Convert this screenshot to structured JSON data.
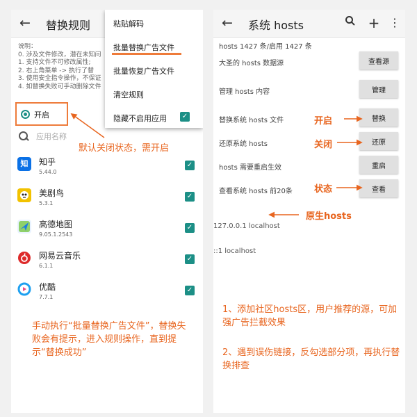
{
  "left": {
    "title": "替换规则",
    "description_lines": [
      "说明：",
      "0. 涉及文件修改，潜在未知问",
      "1. 支持文件不可修改属性;",
      "2. 右上角菜单 -> 执行了替",
      "3. 使用安全指令操作，不保证",
      "4. 如替换失败可手动删除文件"
    ],
    "toggle_label": "开启",
    "search_placeholder": "应用名称",
    "apps": [
      {
        "name": "知乎",
        "version": "5.44.0",
        "icon": "zhihu-icon",
        "glyph": "知",
        "color": "#0b71e6",
        "checked": true
      },
      {
        "name": "美剧鸟",
        "version": "5.3.1",
        "icon": "meijuniao-icon",
        "glyph": "",
        "color": "#f2c200",
        "checked": true
      },
      {
        "name": "高德地图",
        "version": "9.05.1.2543",
        "icon": "amap-icon",
        "glyph": "",
        "color": "#3b8eea",
        "checked": true
      },
      {
        "name": "网易云音乐",
        "version": "6.1.1",
        "icon": "netease-music-icon",
        "glyph": "",
        "color": "#dd2a2a",
        "checked": true
      },
      {
        "name": "优酷",
        "version": "7.7.1",
        "icon": "youku-icon",
        "glyph": "",
        "color": "#1ea0f0",
        "checked": true
      }
    ],
    "menu": {
      "items": [
        "粘贴解码",
        "批量替换广告文件",
        "批量恢复广告文件",
        "清空规则",
        "隐藏不启用应用"
      ],
      "hide_disabled_checked": true
    }
  },
  "right": {
    "title": "系统 hosts",
    "count_text": "hosts 1427 条/启用 1427 条",
    "rows": [
      {
        "label": "大圣的 hosts 数据源",
        "button": "查看源"
      },
      {
        "label": "管理 hosts 内容",
        "button": "管理"
      },
      {
        "label": "替换系统 hosts 文件",
        "button": "替换"
      },
      {
        "label": "还原系统 hosts",
        "button": "还原"
      },
      {
        "label": "hosts 需要重启生效",
        "button": "重启"
      },
      {
        "label": "查看系统 hosts 前20条",
        "button": "查看"
      }
    ],
    "hosts_lines": [
      "127.0.0.1 localhost",
      "::1 localhost"
    ]
  },
  "annotations": {
    "default_off": "默认关闭状态，需开启",
    "manual_run": "手动执行“批量替换广告文件”，替换失败会有提示，进入规则操作，直到提示“替换成功”",
    "enable": "开启",
    "disable": "关闭",
    "status": "状态",
    "native_hosts": "原生hosts",
    "tip1": "1、添加社区hosts区，用户推荐的源，可加强广告拦截效果",
    "tip2": "2、遇到误伤链接，反勾选部分项，再执行替换排查"
  },
  "colors": {
    "accent_orange": "#ee7b3a",
    "annotation_orange": "#e8651f",
    "teal": "#1c8f86"
  }
}
